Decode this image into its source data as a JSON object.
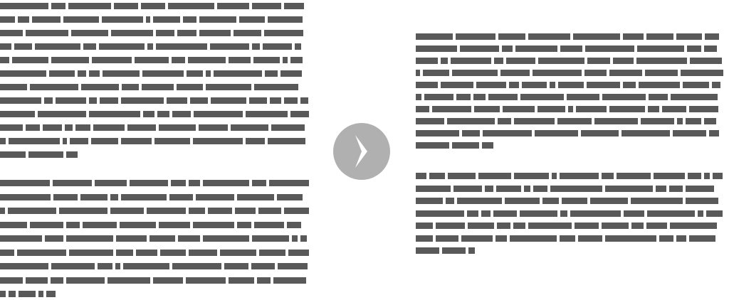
{
  "colors": {
    "background": "#ffffff",
    "text_bar": "#595959",
    "arrow_circle": "#b0b0b0",
    "arrow_chevron": "#ffffff"
  },
  "icons": {
    "arrow": "chevron-right-icon"
  }
}
